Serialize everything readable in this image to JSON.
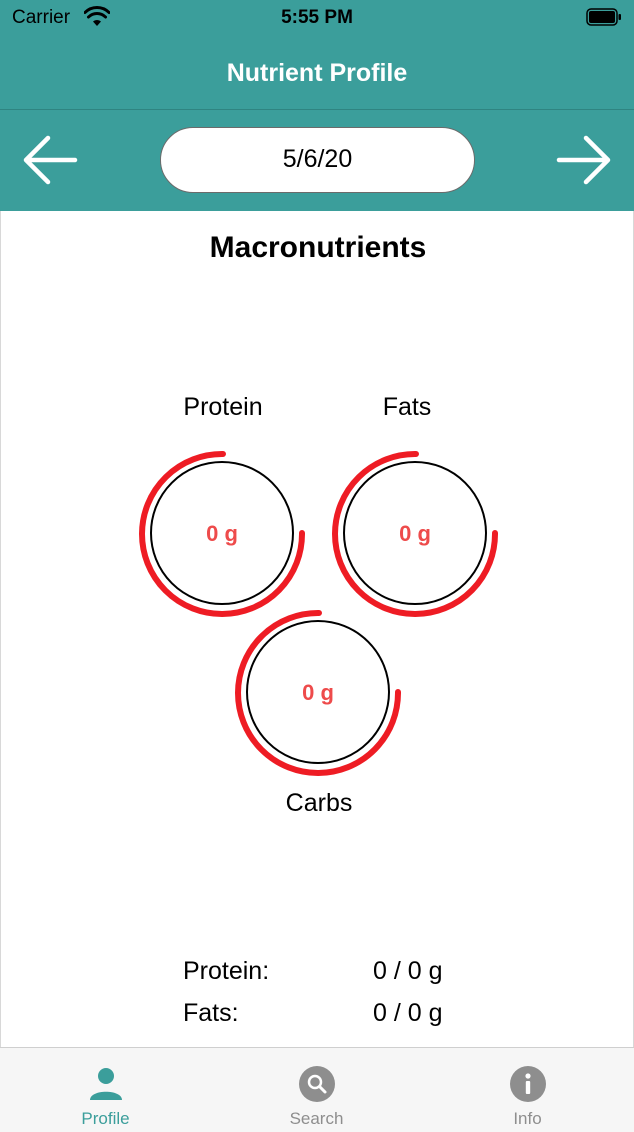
{
  "status_bar": {
    "carrier": "Carrier",
    "time": "5:55 PM"
  },
  "nav": {
    "title": "Nutrient Profile"
  },
  "date_nav": {
    "date": "5/6/20",
    "prev_icon": "arrow-left-icon",
    "next_icon": "arrow-right-icon"
  },
  "section": {
    "title": "Macronutrients"
  },
  "rings": [
    {
      "label": "Protein",
      "value": "0 g"
    },
    {
      "label": "Fats",
      "value": "0 g"
    },
    {
      "label": "Carbs",
      "value": "0 g"
    }
  ],
  "summary": [
    {
      "label": "Protein:",
      "value": "0 / 0 g"
    },
    {
      "label": "Fats:",
      "value": "0 / 0 g"
    }
  ],
  "tabs": [
    {
      "label": "Profile",
      "icon": "person-icon",
      "active": true
    },
    {
      "label": "Search",
      "icon": "search-icon",
      "active": false
    },
    {
      "label": "Info",
      "icon": "info-icon",
      "active": false
    }
  ],
  "colors": {
    "brand": "#3b9e9b",
    "ring": "#ee1c24",
    "ring_value": "#ee4b4b",
    "inactive": "#8e8e8e"
  }
}
